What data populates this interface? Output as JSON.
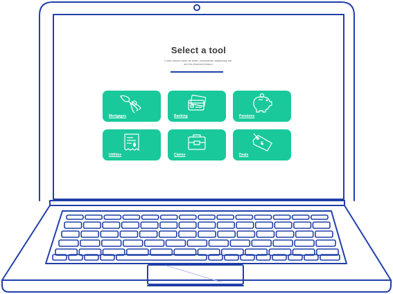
{
  "screen": {
    "title": "Select a tool",
    "subtitle": "Lorem ipsum dolor sit amet, consectetur adipiscing elit, sed do eiusmod tempor"
  },
  "tools": [
    {
      "label": "Mortgages",
      "icon": "keys-icon"
    },
    {
      "label": "Banking",
      "icon": "cards-icon"
    },
    {
      "label": "Pensions",
      "icon": "piggy-bank-icon"
    },
    {
      "label": "Utilities",
      "icon": "bill-icon"
    },
    {
      "label": "Claims",
      "icon": "briefcase-icon"
    },
    {
      "label": "Deals",
      "icon": "price-tag-icon"
    }
  ],
  "colors": {
    "accent": "#19c99b",
    "outline": "#1f3fa8",
    "title": "#3b3b3b"
  }
}
